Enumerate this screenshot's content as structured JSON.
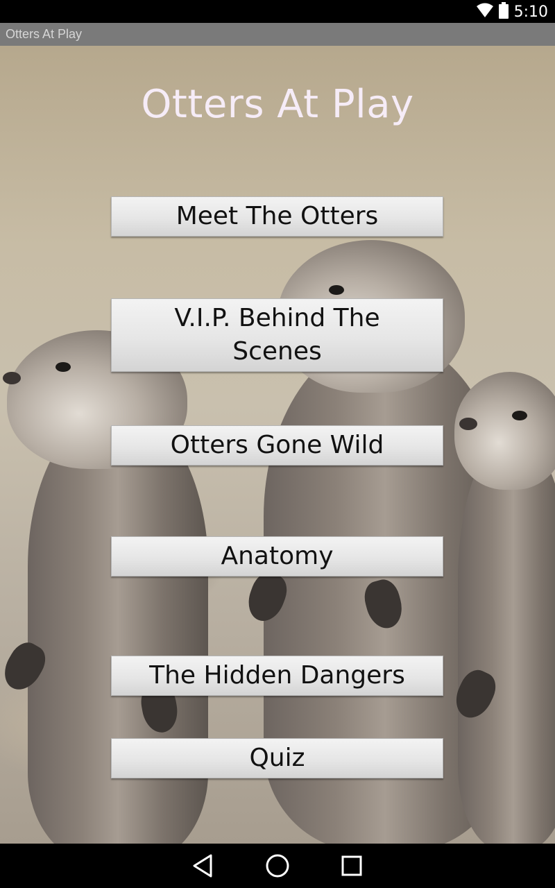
{
  "status_bar": {
    "time": "5:10",
    "icons": [
      "wifi-icon",
      "battery-icon"
    ]
  },
  "title_bar": {
    "app_title": "Otters At Play"
  },
  "main": {
    "page_title": "Otters At Play",
    "buttons": [
      {
        "label": "Meet The Otters"
      },
      {
        "label": "V.I.P. Behind The Scenes"
      },
      {
        "label": "Otters Gone Wild"
      },
      {
        "label": "Anatomy"
      },
      {
        "label": "The Hidden Dangers"
      },
      {
        "label": "Quiz"
      }
    ]
  },
  "nav_bar": {
    "icons": [
      "back-icon",
      "home-icon",
      "recents-icon"
    ]
  },
  "colors": {
    "title_text": "#f6ecf7",
    "title_bar_bg": "#7a7a7a",
    "button_bg": "#e6e6e6"
  }
}
